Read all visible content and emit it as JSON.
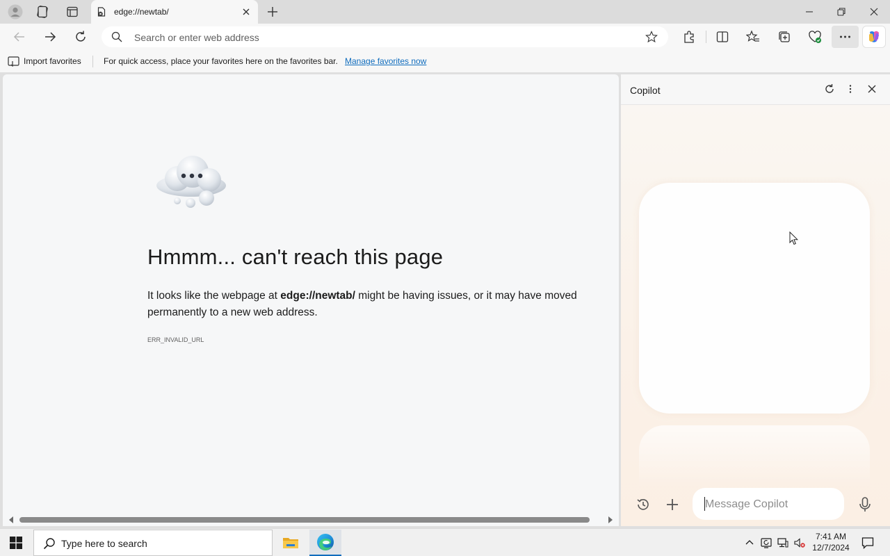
{
  "tab": {
    "title": "edge://newtab/"
  },
  "omnibox": {
    "placeholder": "Search or enter web address"
  },
  "favorites_bar": {
    "import_label": "Import favorites",
    "message": "For quick access, place your favorites here on the favorites bar.",
    "manage_link": "Manage favorites now"
  },
  "error": {
    "title": "Hmmm... can't reach this page",
    "body_prefix": "It looks like the webpage at ",
    "url": "edge://newtab/",
    "body_suffix": " might be having issues, or it may have moved permanently to a new web address.",
    "code": "ERR_INVALID_URL"
  },
  "copilot": {
    "title": "Copilot",
    "message_placeholder": "Message Copilot"
  },
  "taskbar": {
    "search_placeholder": "Type here to search",
    "time": "7:41 AM",
    "date": "12/7/2024"
  },
  "colors": {
    "accent": "#0f6cbd",
    "page_bg": "#f6f7f8",
    "chrome_bg": "#f7f7f7"
  }
}
